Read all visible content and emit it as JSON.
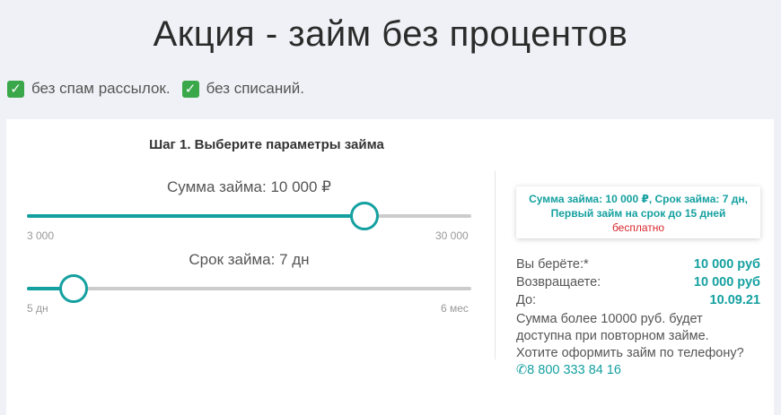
{
  "page": {
    "title": "Акция - займ без процентов",
    "features": [
      "без спам рассылок.",
      "без списаний."
    ]
  },
  "form": {
    "step_title": "Шаг 1. Выберите параметры займа",
    "amount": {
      "label": "Сумма займа: 10 000 ₽",
      "min_label": "3 000",
      "max_label": "30 000",
      "value": 10000,
      "min": 3000,
      "max": 30000,
      "fill_fraction": 0.76
    },
    "term": {
      "label": "Срок займа: 7 дн",
      "min_label": "5 дн",
      "max_label": "6 мес",
      "value_days": 7,
      "fill_fraction": 0.105
    }
  },
  "summary": {
    "info_line1": "Сумма займа: 10 000 ₽, Срок займа: 7 дн,",
    "info_line2": "Первый займ на срок до 15 дней",
    "info_free": "бесплатно",
    "take_label": "Вы берёте:*",
    "take_value": "10 000 руб",
    "return_label": "Возвращаете:",
    "return_value": "10 000 руб",
    "due_label": "До:",
    "due_value": "10.09.21",
    "note": "Сумма более 10000 руб. будет доступна при повторном займе.",
    "phone_prompt": "Хотите оформить займ по телефону?",
    "phone": "8 800 333 84 16"
  },
  "colors": {
    "accent": "#15a0a0",
    "free": "#d9262c",
    "check": "#3aa84a"
  },
  "icons": {
    "check": "check-icon",
    "phone": "phone-icon"
  }
}
